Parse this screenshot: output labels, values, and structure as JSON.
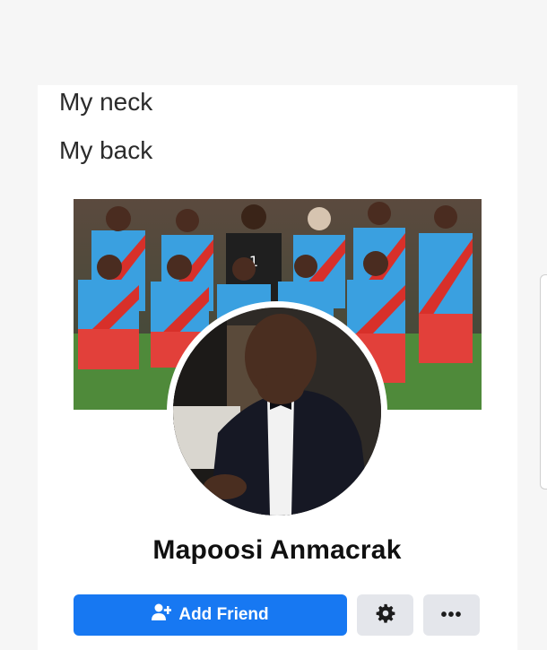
{
  "caption": {
    "line1": "My neck",
    "line2": "My back"
  },
  "profile": {
    "name": "Mapoosi Anmacrak",
    "cover_photo": "team-photo",
    "avatar_photo": "man-in-tuxedo"
  },
  "actions": {
    "add_friend_label": "Add Friend",
    "add_friend_icon": "person-plus-icon",
    "settings_icon": "gear-icon",
    "more_label": "•••"
  },
  "colors": {
    "primary": "#1778f2",
    "secondary_button": "#e4e6eb",
    "text": "#101010"
  }
}
